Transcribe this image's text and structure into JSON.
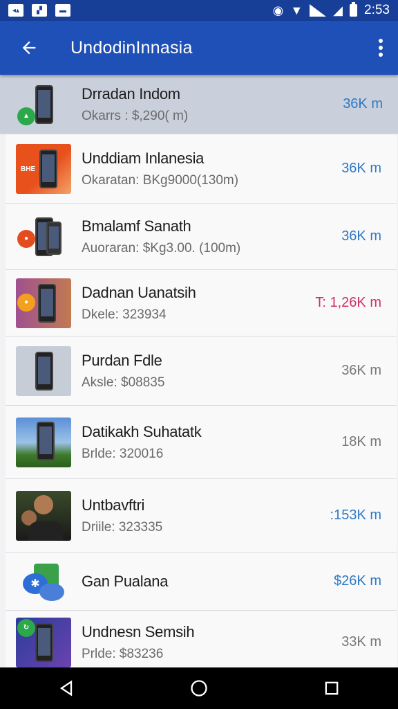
{
  "status_bar": {
    "time": "2:53",
    "icons": [
      "notification-icon",
      "gallery-icon",
      "message-icon",
      "alarm-icon",
      "wifi-icon",
      "signal-icon",
      "no-sim-icon",
      "battery-icon"
    ]
  },
  "app_bar": {
    "title": "UndodinInnasia",
    "back_icon": "arrow-left-icon",
    "menu_icon": "more-vert-icon"
  },
  "list": [
    {
      "name": "Drradan Indom",
      "sub": "Okarrs : $,290( m)",
      "distance": "36K m",
      "dist_color": "blue",
      "highlighted": true,
      "thumb": "phone-green-badge"
    },
    {
      "name": "Unddiam Inlanesia",
      "sub": "Okaratan: BKg9000(130m)",
      "distance": "36K m",
      "dist_color": "blue",
      "highlighted": false,
      "thumb": "phone-orange-banner"
    },
    {
      "name": "Bmalamf Sanath",
      "sub": "Auoraran: $Kg3.00. (100m)",
      "distance": "36K m",
      "dist_color": "blue",
      "highlighted": false,
      "thumb": "phones-orange-badge"
    },
    {
      "name": "Dadnan Uanatsih",
      "sub": "Dkele: 323934",
      "distance": "T: 1,26K m",
      "dist_color": "pink",
      "highlighted": false,
      "thumb": "phone-purple"
    },
    {
      "name": "Purdan Fdle",
      "sub": "Aksle: $08835",
      "distance": "36K m",
      "dist_color": "grey",
      "highlighted": false,
      "thumb": "phone-grey"
    },
    {
      "name": "Datikakh Suhatatk",
      "sub": "Brlde: 320016",
      "distance": "18K m",
      "dist_color": "grey",
      "highlighted": false,
      "thumb": "phone-landscape"
    },
    {
      "name": "Untbavftri",
      "sub": "Driile: 323335",
      "distance": ":153K m",
      "dist_color": "blue",
      "highlighted": false,
      "thumb": "people-photo"
    },
    {
      "name": "Gan Pualana",
      "sub": "",
      "distance": "$26K m",
      "dist_color": "blue",
      "highlighted": false,
      "thumb": "chat-icon"
    },
    {
      "name": "Undnesn Semsih",
      "sub": "Prlde: $83236",
      "distance": "33K m",
      "dist_color": "grey",
      "highlighted": false,
      "thumb": "phone-blue"
    }
  ],
  "badges": {
    "row2": "BHE"
  },
  "nav_bar": {
    "icons": [
      "back-triangle-icon",
      "home-circle-icon",
      "recents-square-icon"
    ]
  },
  "colors": {
    "app_bar": "#1f50b7",
    "status_bar": "#173f98",
    "accent_blue": "#2d79c6",
    "accent_pink": "#cf2f6a"
  }
}
